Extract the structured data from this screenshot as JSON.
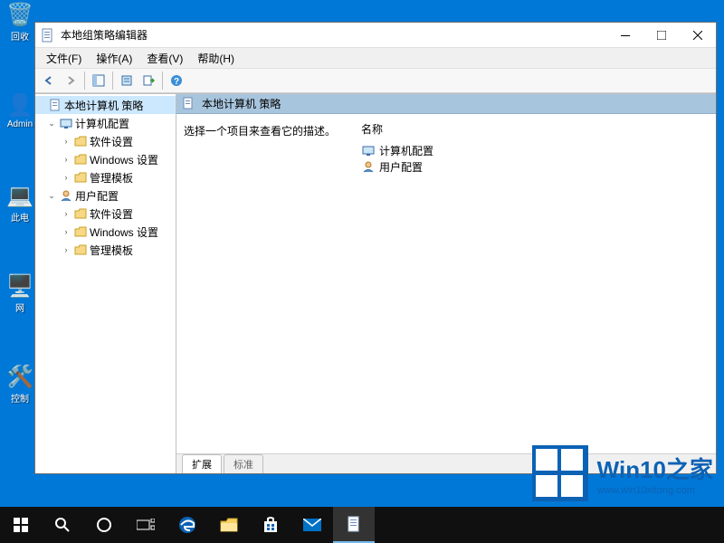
{
  "desktop": {
    "icons": [
      {
        "name": "recycle-bin",
        "label": "回收",
        "glyph": "🗑"
      },
      {
        "name": "admin",
        "label": "Admin",
        "glyph": "👤"
      },
      {
        "name": "this-pc",
        "label": "此电",
        "glyph": "💻"
      },
      {
        "name": "network",
        "label": "网",
        "glyph": "🖧"
      },
      {
        "name": "control-panel",
        "label": "控制",
        "glyph": "⚙"
      }
    ]
  },
  "window": {
    "title": "本地组策略编辑器",
    "menus": {
      "file": "文件(F)",
      "action": "操作(A)",
      "view": "查看(V)",
      "help": "帮助(H)"
    },
    "tree": {
      "root": "本地计算机 策略",
      "computer_config": "计算机配置",
      "user_config": "用户配置",
      "software_settings": "软件设置",
      "windows_settings": "Windows 设置",
      "admin_templates": "管理模板"
    },
    "right": {
      "header": "本地计算机 策略",
      "desc_prompt": "选择一个项目来查看它的描述。",
      "col_name": "名称",
      "items": {
        "computer_config": "计算机配置",
        "user_config": "用户配置"
      }
    },
    "tabs": {
      "extended": "扩展",
      "standard": "标准"
    }
  },
  "watermark": {
    "title": "Win10之家",
    "url": "www.win10xitong.com"
  }
}
